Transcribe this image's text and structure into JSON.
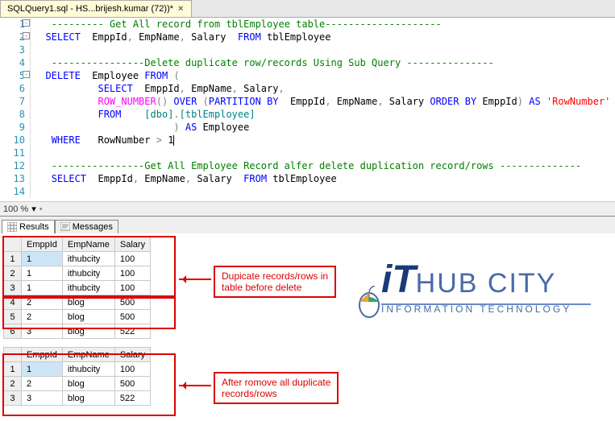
{
  "tab": {
    "title": "SQLQuery1.sql - HS...brijesh.kumar (72))*",
    "close": "×"
  },
  "lines": [
    "--------- Get All record from tblEmployee table--------------------",
    "SELECT  EmppId, EmpName, Salary  FROM tblEmployee",
    "",
    "----------------Delete duplicate row/records Using Sub Query ---------------",
    "DELETE  Employee FROM (",
    "        SELECT  EmppId, EmpName, Salary,",
    "        ROW_NUMBER() OVER (PARTITION BY  EmppId, EmpName, Salary ORDER BY EmppId) AS 'RowNumber'",
    "        FROM    [dbo].[tblEmployee]",
    "                     ) AS Employee",
    "WHERE   RowNumber > 1",
    "",
    "----------------Get All Employee Record alfer delete duplication record/rows --------------",
    "SELECT  EmppId, EmpName, Salary  FROM tblEmployee",
    ""
  ],
  "zoom": "100 %",
  "resultsTab": "Results",
  "messagesTab": "Messages",
  "grid1": {
    "headers": [
      "EmppId",
      "EmpName",
      "Salary"
    ],
    "rows": [
      [
        "1",
        "ithubcity",
        "100"
      ],
      [
        "1",
        "ithubcity",
        "100"
      ],
      [
        "1",
        "ithubcity",
        "100"
      ],
      [
        "2",
        "blog",
        "500"
      ],
      [
        "2",
        "blog",
        "500"
      ],
      [
        "3",
        "blog",
        "522"
      ]
    ]
  },
  "grid2": {
    "headers": [
      "EmppId",
      "EmpName",
      "Salary"
    ],
    "rows": [
      [
        "1",
        "ithubcity",
        "100"
      ],
      [
        "2",
        "blog",
        "500"
      ],
      [
        "3",
        "blog",
        "522"
      ]
    ]
  },
  "callout1": "Dupicate records/rows in\ntable before delete",
  "callout2": "After romove all duplicate\nrecords/rows",
  "logo": {
    "it": "iT",
    "rest": "HUB CITY",
    "sub": "INFORMATION TECHNOLOGY"
  }
}
